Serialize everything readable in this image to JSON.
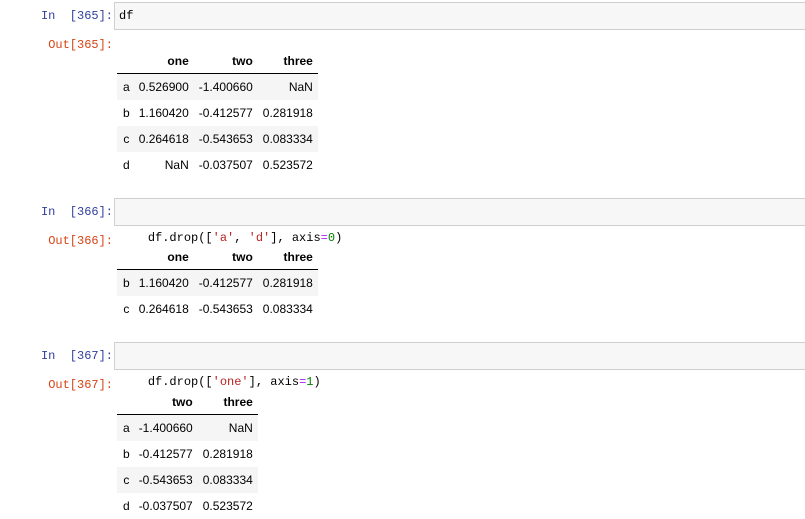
{
  "cells": [
    {
      "in_prompt": "In  [365]:",
      "code": "df",
      "out_prompt": "Out[365]:",
      "table": {
        "columns": [
          "one",
          "two",
          "three"
        ],
        "rows": [
          {
            "index": "a",
            "values": [
              "0.526900",
              "-1.400660",
              "NaN"
            ]
          },
          {
            "index": "b",
            "values": [
              "1.160420",
              "-0.412577",
              "0.281918"
            ]
          },
          {
            "index": "c",
            "values": [
              "0.264618",
              "-0.543653",
              "0.083334"
            ]
          },
          {
            "index": "d",
            "values": [
              "NaN",
              "-0.037507",
              "0.523572"
            ]
          }
        ]
      }
    },
    {
      "in_prompt": "In  [366]:",
      "code_parts": [
        "df.drop([",
        "'a'",
        ", ",
        "'d'",
        "], axis",
        "=",
        "0",
        ")"
      ],
      "out_prompt": "Out[366]:",
      "table": {
        "columns": [
          "one",
          "two",
          "three"
        ],
        "rows": [
          {
            "index": "b",
            "values": [
              "1.160420",
              "-0.412577",
              "0.281918"
            ]
          },
          {
            "index": "c",
            "values": [
              "0.264618",
              "-0.543653",
              "0.083334"
            ]
          }
        ]
      }
    },
    {
      "in_prompt": "In  [367]:",
      "code_parts": [
        "df.drop([",
        "'one'",
        "], axis",
        "=",
        "1",
        ")"
      ],
      "out_prompt": "Out[367]:",
      "table": {
        "columns": [
          "two",
          "three"
        ],
        "rows": [
          {
            "index": "a",
            "values": [
              "-1.400660",
              "NaN"
            ]
          },
          {
            "index": "b",
            "values": [
              "-0.412577",
              "0.281918"
            ]
          },
          {
            "index": "c",
            "values": [
              "-0.543653",
              "0.083334"
            ]
          },
          {
            "index": "d",
            "values": [
              "-0.037507",
              "0.523572"
            ]
          }
        ]
      }
    }
  ],
  "colors": {
    "in_prompt": "#303f9f",
    "out_prompt": "#d84315",
    "code_bg": "#f7f7f7",
    "string": "#ba2121",
    "number": "#008000",
    "operator": "#aa22ff"
  }
}
